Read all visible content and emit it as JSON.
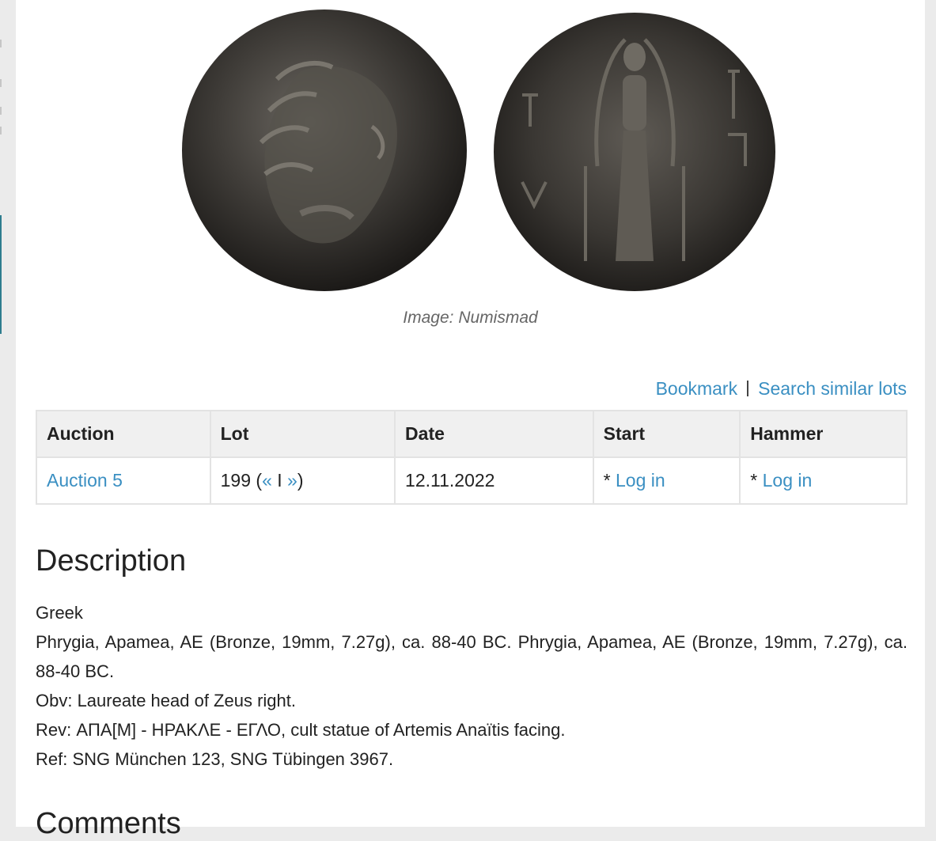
{
  "image": {
    "caption": "Image: Numismad",
    "obverse_alt": "Laureate head of Zeus right",
    "reverse_alt": "Cult statue of Artemis Anaïtis facing"
  },
  "actions": {
    "bookmark": "Bookmark",
    "search_similar": "Search similar lots"
  },
  "table": {
    "headers": [
      "Auction",
      "Lot",
      "Date",
      "Start",
      "Hammer"
    ],
    "row": {
      "auction": "Auction 5",
      "lot_number": "199 (",
      "lot_prev": "«",
      "lot_sep": " I ",
      "lot_next": "»",
      "lot_close": ")",
      "date": "12.11.2022",
      "start_prefix": "* ",
      "start_link": "Log in",
      "hammer_prefix": "* ",
      "hammer_link": "Log in"
    }
  },
  "description": {
    "title": "Description",
    "lines": [
      "Greek",
      "Phrygia, Apamea, AE (Bronze, 19mm, 7.27g), ca. 88-40 BC. Phrygia, Apamea, AE (Bronze, 19mm, 7.27g), ca. 88-40 BC.",
      "Obv: Laureate head of Zeus right.",
      "Rev: ΑΠΑ[Μ] - ΗΡΑΚΛΕ - ΕΓΛΟ, cult statue of Artemis Anaïtis facing.",
      "Ref: SNG München 123, SNG Tübingen 3967."
    ]
  },
  "comments": {
    "title": "Comments"
  },
  "colors": {
    "link": "#3a8fc2",
    "header_bg": "#f0f0f0",
    "page_bg": "#ebebeb"
  }
}
